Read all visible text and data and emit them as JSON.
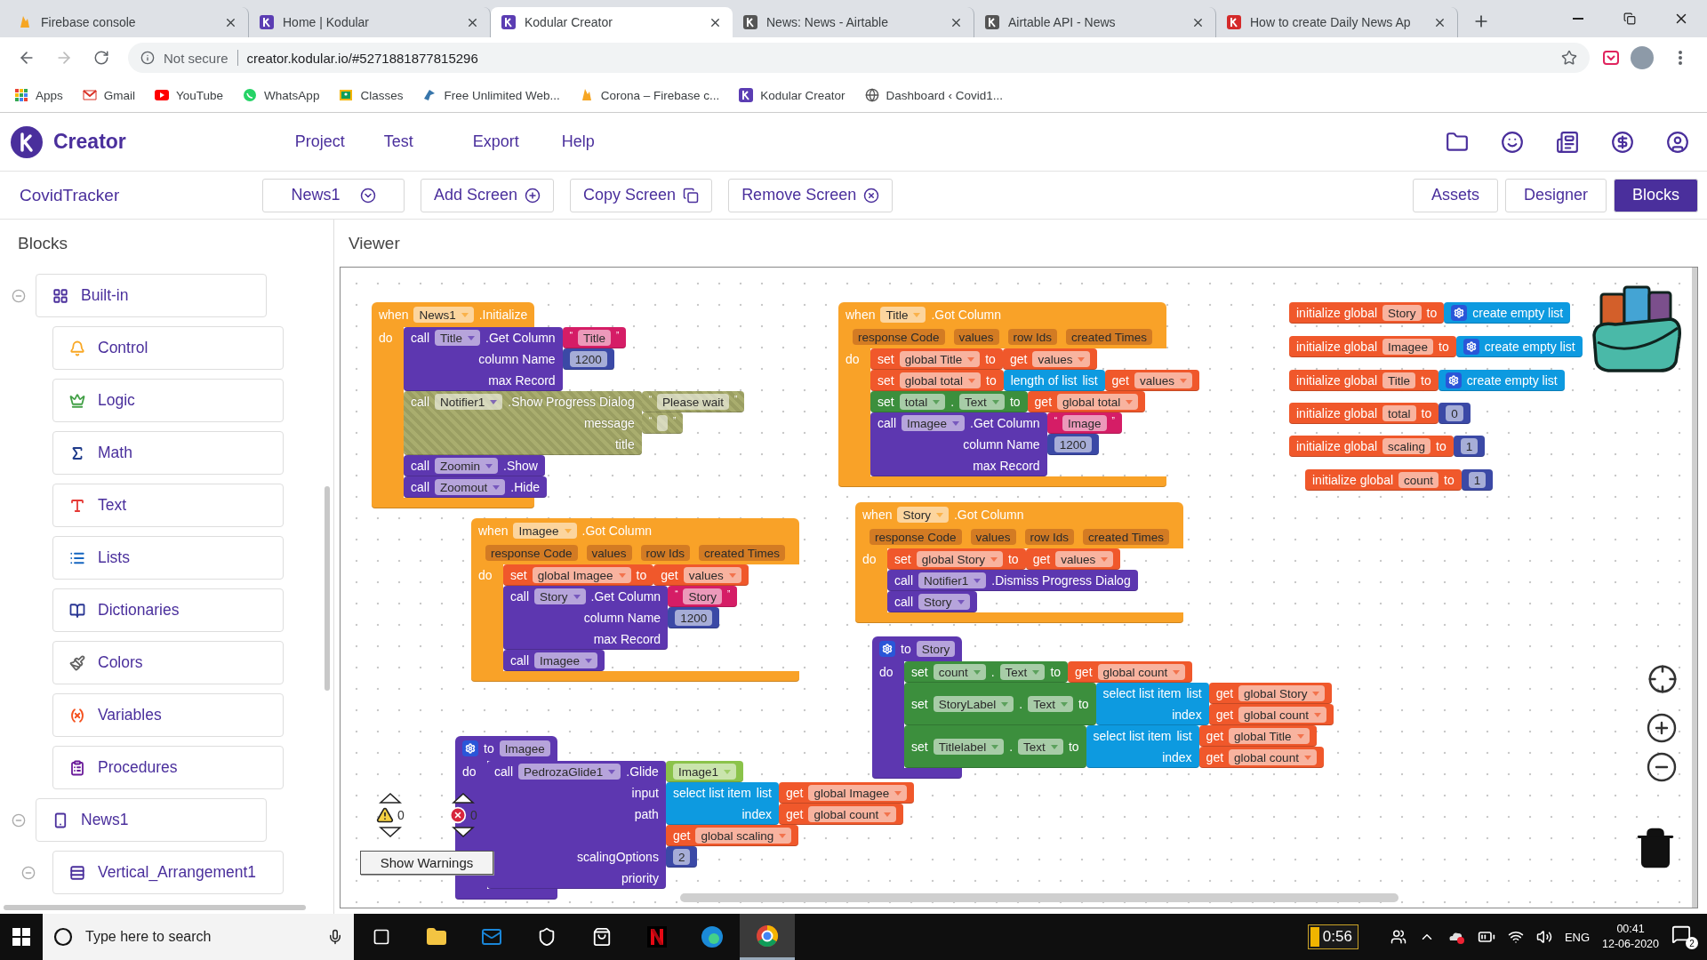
{
  "browser": {
    "tabs": [
      {
        "title": "Firebase console",
        "selected": false
      },
      {
        "title": "Home | Kodular",
        "selected": false
      },
      {
        "title": "Kodular Creator",
        "selected": true
      },
      {
        "title": "News: News - Airtable",
        "selected": false
      },
      {
        "title": "Airtable API - News",
        "selected": false
      },
      {
        "title": "How to create Daily News Ap",
        "selected": false
      }
    ],
    "address": {
      "security": "Not secure",
      "url": "creator.kodular.io/#5271881877815296"
    },
    "bookmarks": [
      "Apps",
      "Gmail",
      "YouTube",
      "WhatsApp",
      "Classes",
      "Free Unlimited Web...",
      "Corona – Firebase c...",
      "Kodular Creator",
      "Dashboard ‹ Covid1..."
    ]
  },
  "app": {
    "logo": "Creator",
    "menu": [
      "Project",
      "Test",
      "Export",
      "Help"
    ],
    "project": "CovidTracker",
    "screen": "News1",
    "actions": [
      "Add Screen",
      "Copy Screen",
      "Remove Screen"
    ],
    "views": [
      {
        "label": "Assets",
        "selected": false
      },
      {
        "label": "Designer",
        "selected": false
      },
      {
        "label": "Blocks",
        "selected": true
      }
    ]
  },
  "blocks_panel": {
    "title": "Blocks",
    "tree": [
      {
        "label": "Built-in",
        "expanded": true,
        "children": [
          {
            "label": "Control"
          },
          {
            "label": "Logic"
          },
          {
            "label": "Math"
          },
          {
            "label": "Text"
          },
          {
            "label": "Lists"
          },
          {
            "label": "Dictionaries"
          },
          {
            "label": "Colors"
          },
          {
            "label": "Variables"
          },
          {
            "label": "Procedures"
          }
        ]
      },
      {
        "label": "News1",
        "expanded": true,
        "children": [
          {
            "label": "Vertical_Arrangement1",
            "expanded": true
          }
        ]
      }
    ]
  },
  "viewer": {
    "title": "Viewer",
    "stacks": [
      {
        "kind": "event",
        "parts": [
          {
            "kind": "word",
            "text": "when"
          },
          {
            "kind": "field",
            "text": "News1"
          },
          {
            "kind": "word",
            "text": ".Initialize"
          }
        ],
        "do": "do",
        "body": [
          {
            "kind": "call",
            "disabled": false,
            "parts": [
              {
                "kind": "word",
                "text": "call"
              },
              {
                "kind": "field",
                "text": "Title"
              },
              {
                "kind": "word",
                "text": ".Get Column"
              }
            ],
            "inputs": [
              {
                "label": "column Name",
                "value": {
                  "kind": "text",
                  "parts": [
                    {
                      "kind": "quote",
                      "text": "“"
                    },
                    {
                      "kind": "name",
                      "text": "Title"
                    },
                    {
                      "kind": "quote",
                      "text": "”"
                    }
                  ]
                }
              },
              {
                "label": "max Record",
                "value": {
                  "kind": "math",
                  "parts": [
                    {
                      "kind": "name",
                      "text": "1200"
                    }
                  ]
                }
              }
            ]
          },
          {
            "kind": "call",
            "disabled": true,
            "parts": [
              {
                "kind": "word",
                "text": "call"
              },
              {
                "kind": "field",
                "text": "Notifier1"
              },
              {
                "kind": "word",
                "text": ".Show Progress Dialog"
              }
            ],
            "inputs": [
              {
                "label": "message",
                "value": {
                  "kind": "text",
                  "parts": [
                    {
                      "kind": "quote",
                      "text": "“"
                    },
                    {
                      "kind": "name",
                      "text": "Please wait"
                    },
                    {
                      "kind": "quote",
                      "text": "”"
                    }
                  ]
                }
              },
              {
                "label": "title",
                "value": {
                  "kind": "text",
                  "parts": [
                    {
                      "kind": "quote",
                      "text": "“"
                    },
                    {
                      "kind": "slot"
                    },
                    {
                      "kind": "quote",
                      "text": "”"
                    }
                  ]
                }
              }
            ]
          },
          {
            "kind": "call",
            "disabled": false,
            "parts": [
              {
                "kind": "word",
                "text": "call"
              },
              {
                "kind": "field",
                "text": "Zoomin"
              },
              {
                "kind": "word",
                "text": ".Show"
              }
            ]
          },
          {
            "kind": "call",
            "disabled": false,
            "parts": [
              {
                "kind": "word",
                "text": "call"
              },
              {
                "kind": "field",
                "text": "Zoomout"
              },
              {
                "kind": "word",
                "text": ".Hide"
              }
            ]
          }
        ]
      },
      {
        "kind": "event",
        "parts": [
          {
            "kind": "word",
            "text": "when"
          },
          {
            "kind": "field",
            "text": "Imagee"
          },
          {
            "kind": "word",
            "text": ".Got Column"
          }
        ],
        "params": [
          "response Code",
          "values",
          "row Ids",
          "created Times"
        ],
        "do": "do",
        "body": [
          {
            "kind": "variables",
            "disabled": false,
            "parts": [
              {
                "kind": "word",
                "text": "set"
              },
              {
                "kind": "field",
                "text": "global Imagee"
              },
              {
                "kind": "word",
                "text": "to"
              }
            ],
            "inputs": [
              {
                "value": {
                  "kind": "variables",
                  "parts": [
                    {
                      "kind": "word",
                      "text": "get"
                    },
                    {
                      "kind": "field",
                      "text": "values"
                    }
                  ]
                }
              }
            ]
          },
          {
            "kind": "call",
            "disabled": false,
            "parts": [
              {
                "kind": "word",
                "text": "call"
              },
              {
                "kind": "field",
                "text": "Story"
              },
              {
                "kind": "word",
                "text": ".Get Column"
              }
            ],
            "inputs": [
              {
                "label": "column Name",
                "value": {
                  "kind": "text",
                  "parts": [
                    {
                      "kind": "quote",
                      "text": "“"
                    },
                    {
                      "kind": "name",
                      "text": "Story"
                    },
                    {
                      "kind": "quote",
                      "text": "”"
                    }
                  ]
                }
              },
              {
                "label": "max Record",
                "value": {
                  "kind": "math",
                  "parts": [
                    {
                      "kind": "name",
                      "text": "1200"
                    }
                  ]
                }
              }
            ]
          },
          {
            "kind": "call",
            "disabled": false,
            "parts": [
              {
                "kind": "word",
                "text": "call"
              },
              {
                "kind": "field",
                "text": "Imagee"
              }
            ]
          }
        ]
      },
      {
        "kind": "event",
        "parts": [
          {
            "kind": "word",
            "text": "when"
          },
          {
            "kind": "field",
            "text": "Title"
          },
          {
            "kind": "word",
            "text": ".Got Column"
          }
        ],
        "params": [
          "response Code",
          "values",
          "row Ids",
          "created Times"
        ],
        "do": "do",
        "body": [
          {
            "kind": "variables",
            "disabled": false,
            "parts": [
              {
                "kind": "word",
                "text": "set"
              },
              {
                "kind": "field",
                "text": "global Title"
              },
              {
                "kind": "word",
                "text": "to"
              }
            ],
            "inputs": [
              {
                "value": {
                  "kind": "variables",
                  "parts": [
                    {
                      "kind": "word",
                      "text": "get"
                    },
                    {
                      "kind": "field",
                      "text": "values"
                    }
                  ]
                }
              }
            ]
          },
          {
            "kind": "variables",
            "disabled": false,
            "parts": [
              {
                "kind": "word",
                "text": "set"
              },
              {
                "kind": "field",
                "text": "global total"
              },
              {
                "kind": "word",
                "text": "to"
              }
            ],
            "inputs": [
              {
                "value": {
                  "kind": "lists",
                  "parts": [
                    {
                      "kind": "word",
                      "text": "length of list"
                    },
                    {
                      "kind": "word",
                      "text": "list"
                    }
                  ],
                  "inputs": [
                    {
                      "value": {
                        "kind": "variables",
                        "parts": [
                          {
                            "kind": "word",
                            "text": "get"
                          },
                          {
                            "kind": "field",
                            "text": "values"
                          }
                        ]
                      }
                    }
                  ]
                }
              }
            ]
          },
          {
            "kind": "setter",
            "disabled": false,
            "parts": [
              {
                "kind": "word",
                "text": "set"
              },
              {
                "kind": "field",
                "text": "total"
              },
              {
                "kind": "word",
                "text": "."
              },
              {
                "kind": "field",
                "text": "Text"
              },
              {
                "kind": "word",
                "text": "to"
              }
            ],
            "inputs": [
              {
                "value": {
                  "kind": "variables",
                  "parts": [
                    {
                      "kind": "word",
                      "text": "get"
                    },
                    {
                      "kind": "field",
                      "text": "global total"
                    }
                  ]
                }
              }
            ]
          },
          {
            "kind": "call",
            "disabled": false,
            "parts": [
              {
                "kind": "word",
                "text": "call"
              },
              {
                "kind": "field",
                "text": "Imagee"
              },
              {
                "kind": "word",
                "text": ".Get Column"
              }
            ],
            "inputs": [
              {
                "label": "column Name",
                "value": {
                  "kind": "text",
                  "parts": [
                    {
                      "kind": "quote",
                      "text": "“"
                    },
                    {
                      "kind": "name",
                      "text": "Image"
                    },
                    {
                      "kind": "quote",
                      "text": "”"
                    }
                  ]
                }
              },
              {
                "label": "max Record",
                "value": {
                  "kind": "math",
                  "parts": [
                    {
                      "kind": "name",
                      "text": "1200"
                    }
                  ]
                }
              }
            ]
          }
        ]
      },
      {
        "kind": "event",
        "parts": [
          {
            "kind": "word",
            "text": "when"
          },
          {
            "kind": "field",
            "text": "Story"
          },
          {
            "kind": "word",
            "text": ".Got Column"
          }
        ],
        "params": [
          "response Code",
          "values",
          "row Ids",
          "created Times"
        ],
        "do": "do",
        "body": [
          {
            "kind": "variables",
            "disabled": false,
            "parts": [
              {
                "kind": "word",
                "text": "set"
              },
              {
                "kind": "field",
                "text": "global Story"
              },
              {
                "kind": "word",
                "text": "to"
              }
            ],
            "inputs": [
              {
                "value": {
                  "kind": "variables",
                  "parts": [
                    {
                      "kind": "word",
                      "text": "get"
                    },
                    {
                      "kind": "field",
                      "text": "values"
                    }
                  ]
                }
              }
            ]
          },
          {
            "kind": "call",
            "disabled": false,
            "parts": [
              {
                "kind": "word",
                "text": "call"
              },
              {
                "kind": "field",
                "text": "Notifier1"
              },
              {
                "kind": "word",
                "text": ".Dismiss Progress Dialog"
              }
            ]
          },
          {
            "kind": "call",
            "disabled": false,
            "parts": [
              {
                "kind": "word",
                "text": "call"
              },
              {
                "kind": "field",
                "text": "Story"
              }
            ]
          }
        ]
      },
      {
        "kind": "procedure",
        "parts": [
          {
            "kind": "gear"
          },
          {
            "kind": "word",
            "text": "to"
          },
          {
            "kind": "name",
            "text": "Story"
          }
        ],
        "do": "do",
        "body": [
          {
            "kind": "setter",
            "disabled": false,
            "parts": [
              {
                "kind": "word",
                "text": "set"
              },
              {
                "kind": "field",
                "text": "count"
              },
              {
                "kind": "word",
                "text": "."
              },
              {
                "kind": "field",
                "text": "Text"
              },
              {
                "kind": "word",
                "text": "to"
              }
            ],
            "inputs": [
              {
                "value": {
                  "kind": "variables",
                  "parts": [
                    {
                      "kind": "word",
                      "text": "get"
                    },
                    {
                      "kind": "field",
                      "text": "global count"
                    }
                  ]
                }
              }
            ]
          },
          {
            "kind": "setter",
            "disabled": false,
            "parts": [
              {
                "kind": "word",
                "text": "set"
              },
              {
                "kind": "field",
                "text": "StoryLabel"
              },
              {
                "kind": "word",
                "text": "."
              },
              {
                "kind": "field",
                "text": "Text"
              },
              {
                "kind": "word",
                "text": "to"
              }
            ],
            "inputs": [
              {
                "value": {
                  "kind": "lists",
                  "parts": [
                    {
                      "kind": "word",
                      "text": "select list item"
                    },
                    {
                      "kind": "word",
                      "text": "list"
                    }
                  ],
                  "inputs": [
                    {
                      "value": {
                        "kind": "variables",
                        "parts": [
                          {
                            "kind": "word",
                            "text": "get"
                          },
                          {
                            "kind": "field",
                            "text": "global Story"
                          }
                        ]
                      }
                    },
                    {
                      "label": "index",
                      "value": {
                        "kind": "variables",
                        "parts": [
                          {
                            "kind": "word",
                            "text": "get"
                          },
                          {
                            "kind": "field",
                            "text": "global count"
                          }
                        ]
                      }
                    }
                  ]
                }
              }
            ]
          },
          {
            "kind": "setter",
            "disabled": false,
            "parts": [
              {
                "kind": "word",
                "text": "set"
              },
              {
                "kind": "field",
                "text": "Titlelabel"
              },
              {
                "kind": "word",
                "text": "."
              },
              {
                "kind": "field",
                "text": "Text"
              },
              {
                "kind": "word",
                "text": "to"
              }
            ],
            "inputs": [
              {
                "value": {
                  "kind": "lists",
                  "parts": [
                    {
                      "kind": "word",
                      "text": "select list item"
                    },
                    {
                      "kind": "word",
                      "text": "list"
                    }
                  ],
                  "inputs": [
                    {
                      "value": {
                        "kind": "variables",
                        "parts": [
                          {
                            "kind": "word",
                            "text": "get"
                          },
                          {
                            "kind": "field",
                            "text": "global Title"
                          }
                        ]
                      }
                    },
                    {
                      "label": "index",
                      "value": {
                        "kind": "variables",
                        "parts": [
                          {
                            "kind": "word",
                            "text": "get"
                          },
                          {
                            "kind": "field",
                            "text": "global count"
                          }
                        ]
                      }
                    }
                  ]
                }
              }
            ]
          }
        ]
      },
      {
        "kind": "procedure",
        "parts": [
          {
            "kind": "gear"
          },
          {
            "kind": "word",
            "text": "to"
          },
          {
            "kind": "name",
            "text": "Imagee"
          }
        ],
        "do": "do",
        "body": [
          {
            "kind": "call",
            "disabled": false,
            "parts": [
              {
                "kind": "word",
                "text": "call"
              },
              {
                "kind": "field",
                "text": "PedrozaGlide1"
              },
              {
                "kind": "word",
                "text": ".Glide"
              }
            ],
            "inputs": [
              {
                "label": "input",
                "value": {
                  "kind": "component",
                  "parts": [
                    {
                      "kind": "field",
                      "text": "Image1"
                    }
                  ]
                }
              },
              {
                "label": "path",
                "value": {
                  "kind": "lists",
                  "parts": [
                    {
                      "kind": "word",
                      "text": "select list item"
                    },
                    {
                      "kind": "word",
                      "text": "list"
                    }
                  ],
                  "inputs": [
                    {
                      "value": {
                        "kind": "variables",
                        "parts": [
                          {
                            "kind": "word",
                            "text": "get"
                          },
                          {
                            "kind": "field",
                            "text": "global Imagee"
                          }
                        ]
                      }
                    },
                    {
                      "label": "index",
                      "value": {
                        "kind": "variables",
                        "parts": [
                          {
                            "kind": "word",
                            "text": "get"
                          },
                          {
                            "kind": "field",
                            "text": "global count"
                          }
                        ]
                      }
                    }
                  ]
                }
              },
              {
                "label": "scalingOptions",
                "value": {
                  "kind": "variables",
                  "parts": [
                    {
                      "kind": "word",
                      "text": "get"
                    },
                    {
                      "kind": "field",
                      "text": "global scaling"
                    }
                  ]
                }
              },
              {
                "label": "priority",
                "value": {
                  "kind": "math",
                  "parts": [
                    {
                      "kind": "name",
                      "text": "2"
                    }
                  ]
                }
              }
            ]
          }
        ]
      },
      {
        "kind": "global",
        "parts": [
          {
            "kind": "word",
            "text": "initialize global"
          },
          {
            "kind": "name",
            "text": "Story"
          },
          {
            "kind": "word",
            "text": "to"
          }
        ],
        "inputs": [
          {
            "value": {
              "kind": "lists",
              "parts": [
                {
                  "kind": "gear"
                },
                {
                  "kind": "word",
                  "text": "create empty list"
                }
              ]
            }
          }
        ]
      },
      {
        "kind": "global",
        "parts": [
          {
            "kind": "word",
            "text": "initialize global"
          },
          {
            "kind": "name",
            "text": "Imagee"
          },
          {
            "kind": "word",
            "text": "to"
          }
        ],
        "inputs": [
          {
            "value": {
              "kind": "lists",
              "parts": [
                {
                  "kind": "gear"
                },
                {
                  "kind": "word",
                  "text": "create empty list"
                }
              ]
            }
          }
        ]
      },
      {
        "kind": "global",
        "parts": [
          {
            "kind": "word",
            "text": "initialize global"
          },
          {
            "kind": "name",
            "text": "Title"
          },
          {
            "kind": "word",
            "text": "to"
          }
        ],
        "inputs": [
          {
            "value": {
              "kind": "lists",
              "parts": [
                {
                  "kind": "gear"
                },
                {
                  "kind": "word",
                  "text": "create empty list"
                }
              ]
            }
          }
        ]
      },
      {
        "kind": "global",
        "parts": [
          {
            "kind": "word",
            "text": "initialize global"
          },
          {
            "kind": "name",
            "text": "total"
          },
          {
            "kind": "word",
            "text": "to"
          }
        ],
        "inputs": [
          {
            "value": {
              "kind": "math",
              "parts": [
                {
                  "kind": "name",
                  "text": "0"
                }
              ]
            }
          }
        ]
      },
      {
        "kind": "global",
        "parts": [
          {
            "kind": "word",
            "text": "initialize global"
          },
          {
            "kind": "name",
            "text": "scaling"
          },
          {
            "kind": "word",
            "text": "to"
          }
        ],
        "inputs": [
          {
            "value": {
              "kind": "math",
              "parts": [
                {
                  "kind": "name",
                  "text": "1"
                }
              ]
            }
          }
        ]
      },
      {
        "kind": "global",
        "parts": [
          {
            "kind": "word",
            "text": "initialize global"
          },
          {
            "kind": "name",
            "text": "count"
          },
          {
            "kind": "word",
            "text": "to"
          }
        ],
        "inputs": [
          {
            "value": {
              "kind": "math",
              "parts": [
                {
                  "kind": "name",
                  "text": "1"
                }
              ]
            }
          }
        ]
      }
    ],
    "warnings": {
      "warning_count": "0",
      "error_count": "0",
      "button": "Show Warnings"
    }
  },
  "taskbar": {
    "search_placeholder": "Type here to search",
    "battery": "0:56",
    "language": "ENG",
    "time": "00:41",
    "date": "12-06-2020",
    "notifications": "2"
  }
}
